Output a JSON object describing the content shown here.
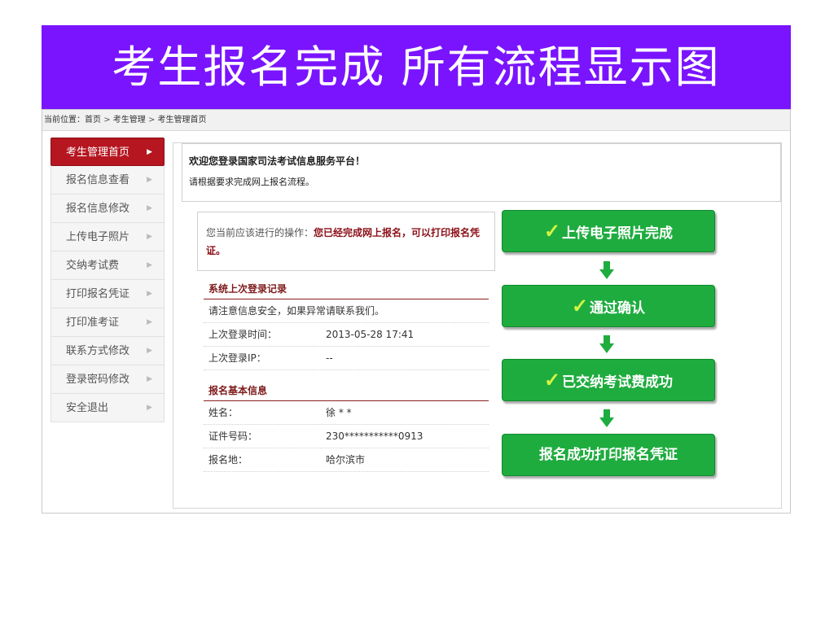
{
  "slide_title": "考生报名完成 所有流程显示图",
  "breadcrumb": {
    "prefix": "当前位置：",
    "items": [
      "首页",
      "考生管理",
      "考生管理首页"
    ]
  },
  "sidebar": {
    "items": [
      {
        "label": "考生管理首页"
      },
      {
        "label": "报名信息查看"
      },
      {
        "label": "报名信息修改"
      },
      {
        "label": "上传电子照片"
      },
      {
        "label": "交纳考试费"
      },
      {
        "label": "打印报名凭证"
      },
      {
        "label": "打印准考证"
      },
      {
        "label": "联系方式修改"
      },
      {
        "label": "登录密码修改"
      },
      {
        "label": "安全退出"
      }
    ],
    "active_index": 0
  },
  "welcome": {
    "title": "欢迎您登录国家司法考试信息服务平台！",
    "subtitle": "请根据要求完成网上报名流程。"
  },
  "operation": {
    "label": "您当前应该进行的操作：",
    "value": "您已经完成网上报名，可以打印报名凭证。"
  },
  "last_login": {
    "title": "系统上次登录记录",
    "notice": "请注意信息安全，如果异常请联系我们。",
    "time_label": "上次登录时间：",
    "time_value": "2013-05-28 17:41",
    "ip_label": "上次登录IP：",
    "ip_value": "--"
  },
  "basic_info": {
    "title": "报名基本信息",
    "name_label": "姓名：",
    "name_value": "徐 * *",
    "id_label": "证件号码：",
    "id_value": "230***********0913",
    "place_label": "报名地：",
    "place_value": "哈尔滨市"
  },
  "flow_steps": [
    {
      "label": "上传电子照片完成",
      "checked": true
    },
    {
      "label": "通过确认",
      "checked": true
    },
    {
      "label": "已交纳考试费成功",
      "checked": true
    },
    {
      "label": "报名成功打印报名凭证",
      "checked": false
    }
  ],
  "colors": {
    "banner": "#7a14ff",
    "active_menu": "#b51620",
    "flow_green": "#1fac3f",
    "section_title": "#7d1a1a"
  }
}
